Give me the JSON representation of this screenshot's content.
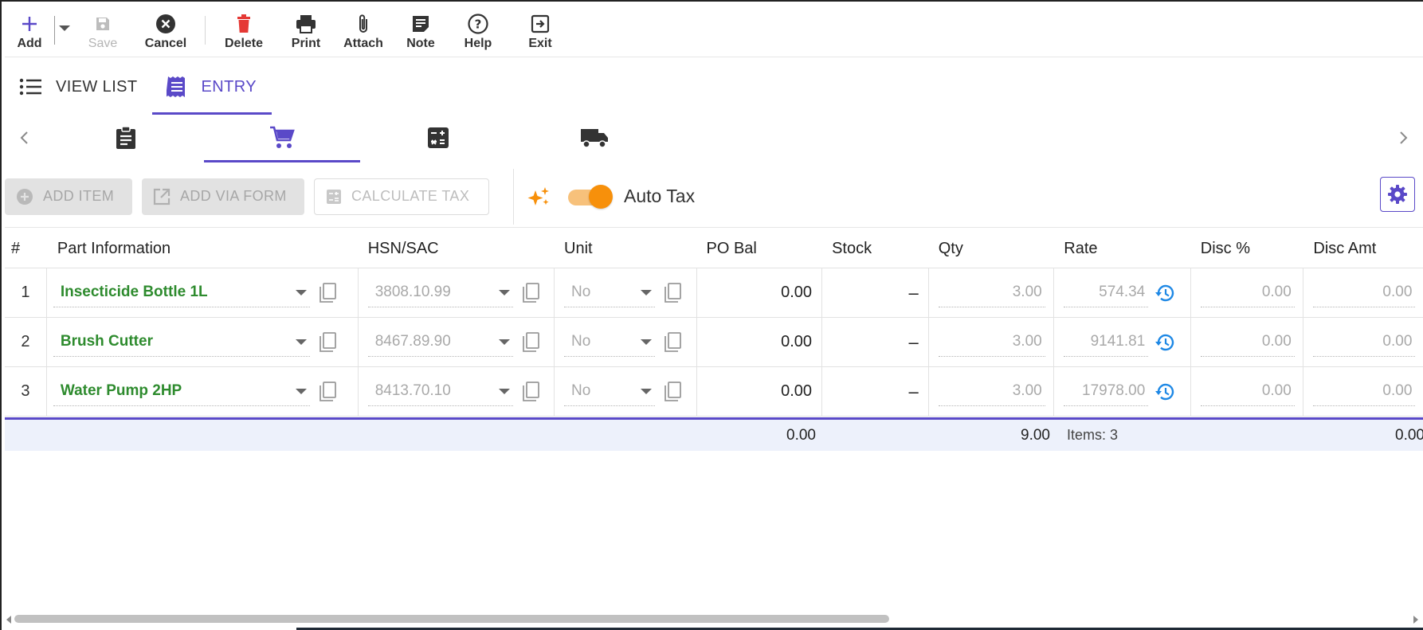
{
  "toolbar": {
    "add": "Add",
    "save": "Save",
    "cancel": "Cancel",
    "delete": "Delete",
    "print": "Print",
    "attach": "Attach",
    "note": "Note",
    "help": "Help",
    "exit": "Exit"
  },
  "view_tabs": {
    "view_list": "VIEW LIST",
    "entry": "ENTRY"
  },
  "section_tabs": [
    {
      "icon": "clipboard-icon",
      "active": false
    },
    {
      "icon": "cart-icon",
      "active": true
    },
    {
      "icon": "calculator-icon",
      "active": false
    },
    {
      "icon": "truck-icon",
      "active": false
    }
  ],
  "actions": {
    "add_item": "ADD ITEM",
    "add_via_form": "ADD VIA FORM",
    "calculate_tax": "CALCULATE TAX",
    "auto_tax_label": "Auto Tax",
    "auto_tax_on": true
  },
  "columns": {
    "num": "#",
    "part": "Part Information",
    "hsn": "HSN/SAC",
    "unit": "Unit",
    "pobal": "PO Bal",
    "stock": "Stock",
    "qty": "Qty",
    "rate": "Rate",
    "disc_pct": "Disc %",
    "disc_amt": "Disc Amt"
  },
  "rows": [
    {
      "num": "1",
      "part": "Insecticide Bottle 1L",
      "hsn": "3808.10.99",
      "unit": "No",
      "pobal": "0.00",
      "stock": "–",
      "qty": "3.00",
      "rate": "574.34",
      "disc_pct": "0.00",
      "disc_amt": "0.00"
    },
    {
      "num": "2",
      "part": "Brush Cutter",
      "hsn": "8467.89.90",
      "unit": "No",
      "pobal": "0.00",
      "stock": "–",
      "qty": "3.00",
      "rate": "9141.81",
      "disc_pct": "0.00",
      "disc_amt": "0.00"
    },
    {
      "num": "3",
      "part": "Water Pump 2HP",
      "hsn": "8413.70.10",
      "unit": "No",
      "pobal": "0.00",
      "stock": "–",
      "qty": "3.00",
      "rate": "17978.00",
      "disc_pct": "0.00",
      "disc_amt": "0.00"
    }
  ],
  "totals": {
    "pobal": "0.00",
    "qty": "9.00",
    "items": "Items: 3",
    "disc_amt": "0.00"
  },
  "colors": {
    "accent": "#5a49c8",
    "part_text": "#2e8b2e",
    "delete_icon": "#e53935",
    "toggle": "#f7900b",
    "history_icon": "#1e88e5"
  }
}
